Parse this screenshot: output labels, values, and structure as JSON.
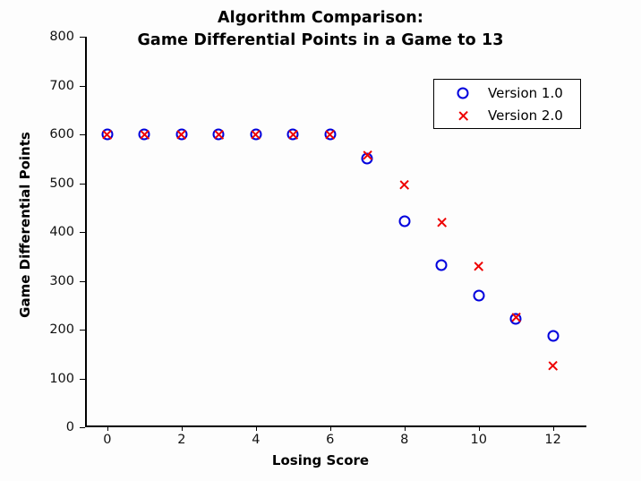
{
  "chart_data": {
    "type": "scatter",
    "title": "Algorithm Comparison:\nGame Differential Points in a Game to 13",
    "title_lines": [
      "Algorithm Comparison:",
      "Game Differential Points in a Game to 13"
    ],
    "xlabel": "Losing Score",
    "ylabel": "Game Differential Points",
    "xlim": [
      -0.6,
      12.9
    ],
    "ylim": [
      0,
      800
    ],
    "xticks": [
      0,
      2,
      4,
      6,
      8,
      10,
      12
    ],
    "xtick_labels": [
      "0",
      "2",
      "4",
      "6",
      "8",
      "10",
      "12"
    ],
    "yticks": [
      0,
      100,
      200,
      300,
      400,
      500,
      600,
      700,
      800
    ],
    "ytick_labels": [
      "0",
      "100",
      "200",
      "300",
      "400",
      "500",
      "600",
      "700",
      "800"
    ],
    "grid": false,
    "legend_position": "upper right",
    "x": [
      0,
      1,
      2,
      3,
      4,
      5,
      6,
      7,
      8,
      9,
      10,
      11,
      12
    ],
    "series": [
      {
        "name": "Version 1.0",
        "marker": "circle",
        "color": "#0000dd",
        "values": [
          600,
          600,
          600,
          600,
          600,
          600,
          600,
          550,
          422,
          333,
          269,
          222,
          187
        ]
      },
      {
        "name": "Version 2.0",
        "marker": "cross",
        "color": "#ee0000",
        "values": [
          600,
          600,
          600,
          600,
          600,
          600,
          600,
          556,
          497,
          419,
          329,
          224,
          125
        ]
      }
    ]
  },
  "legend": {
    "entries": [
      {
        "label": "Version 1.0",
        "symbol": "circle-marker-icon"
      },
      {
        "label": "Version 2.0",
        "symbol": "cross-marker-icon"
      }
    ]
  }
}
